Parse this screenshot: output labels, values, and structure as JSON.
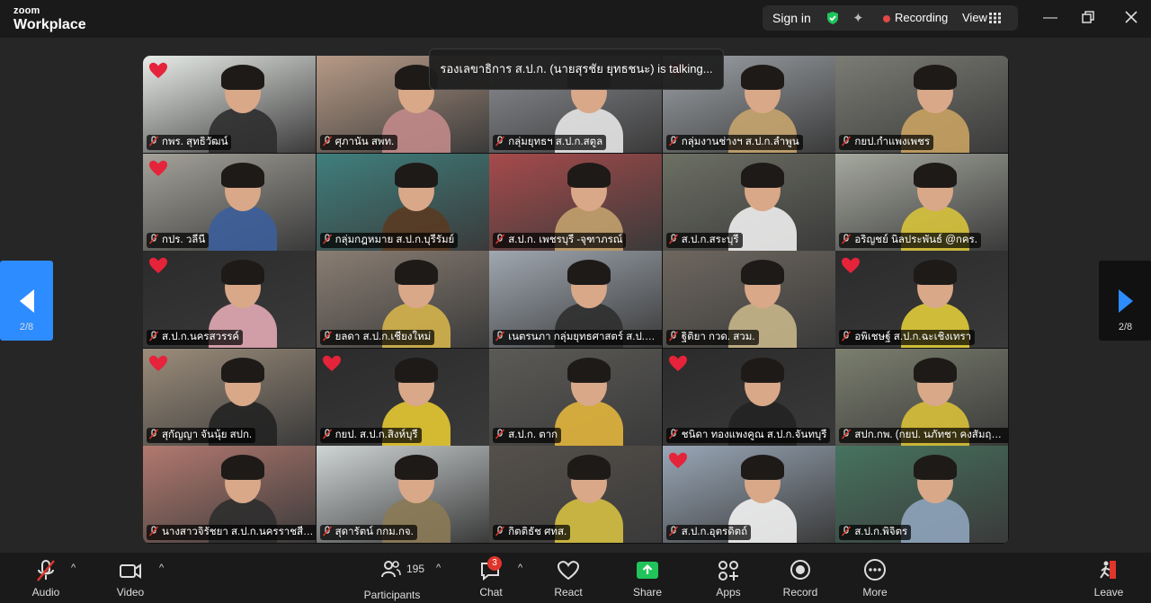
{
  "app": {
    "logo_line1": "zoom",
    "logo_line2": "Workplace"
  },
  "topbar": {
    "sign_in": "Sign in",
    "recording": "Recording",
    "view": "View",
    "recording_dot_color": "#e04848",
    "shield_color": "#21c35b"
  },
  "talking_banner": "รองเลขาธิการ ส.ป.ก. (นายสุรชัย ยุทธชนะ) is talking...",
  "pager": {
    "left": "2/8",
    "right": "2/8"
  },
  "participants": [
    {
      "name": "กพร. สุทธิวัฒน์",
      "heart": true,
      "bg": "#e8ece8",
      "clothes": "#2d2d2d"
    },
    {
      "name": "ศุภานัน สพท.",
      "heart": false,
      "bg": "#b79a86",
      "clothes": "#c28a8a"
    },
    {
      "name": "กลุ่มยุทธฯ ส.ป.ก.สตูล",
      "heart": false,
      "bg": "#8d8f95",
      "clothes": "#e5e5e5"
    },
    {
      "name": "กลุ่มงานช่างฯ ส.ป.ก.ลำพูน",
      "heart": true,
      "bg": "#9ea3a8",
      "clothes": "#c7a46e"
    },
    {
      "name": "กยป.กำแพงเพชร",
      "heart": false,
      "bg": "#7b7c74",
      "clothes": "#c9a262"
    },
    {
      "name": "กปร. วลีนี",
      "heart": true,
      "bg": "#a4a29a",
      "clothes": "#3b5e9b"
    },
    {
      "name": "กลุ่มกฎหมาย ส.ป.ก.บุรีรัมย์",
      "heart": false,
      "bg": "#3e7f7d",
      "clothes": "#5a3b22"
    },
    {
      "name": "ส.ป.ก. เพชรบุรี -จุฑาภรณ์",
      "heart": false,
      "bg": "#a74a4b",
      "clothes": "#c2a16d"
    },
    {
      "name": "ส.ป.ก.สระบุรี",
      "heart": false,
      "bg": "#6d7064",
      "clothes": "#eeeeee"
    },
    {
      "name": "อริญชย์ นิลประพันธ์ @กคร.",
      "heart": false,
      "bg": "#a6a99f",
      "clothes": "#d7c23b"
    },
    {
      "name": "ส.ป.ก.นครสวรรค์",
      "heart": true,
      "bg": "#2b2b2b",
      "clothes": "#e2a8b3"
    },
    {
      "name": "ยลดา ส.ป.ก.เชียงใหม่",
      "heart": false,
      "bg": "#8a7e73",
      "clothes": "#d4b44b"
    },
    {
      "name": "เนตรนภา กลุ่มยุทธศาสตร์ ส.ป.ก.ร้อยเอ็ด",
      "heart": false,
      "bg": "#9fa7b0",
      "clothes": "#2f2f2f"
    },
    {
      "name": "ฐิติยา กวด. สวม.",
      "heart": false,
      "bg": "#6e675f",
      "clothes": "#c7b68a"
    },
    {
      "name": "อพิเชษฐ์ ส.ป.ก.ฉะเชิงเทรา",
      "heart": true,
      "bg": "#2b2b2b",
      "clothes": "#e0cc3a"
    },
    {
      "name": "สุกัญญา จันนุ้ย สปก.",
      "heart": true,
      "bg": "#9c8d7b",
      "clothes": "#222222"
    },
    {
      "name": "กยป. ส.ป.ก.สิงห์บุรี",
      "heart": true,
      "bg": "#2b2b2b",
      "clothes": "#e5c832"
    },
    {
      "name": "ส.ป.ก. ตาก",
      "heart": false,
      "bg": "#5b5a56",
      "clothes": "#e2b53c"
    },
    {
      "name": "ชนิดา ทองแพงคูณ ส.ป.ก.จันทบุรี",
      "heart": true,
      "bg": "#2b2b2b",
      "clothes": "#222222"
    },
    {
      "name": "สปก.กพ. (กยป. นภัทชา คงสัมฤทธิ์)",
      "heart": false,
      "bg": "#7b7f6e",
      "clothes": "#d8c038"
    },
    {
      "name": "นางสาวจิรัชยา ส.ป.ก.นครราชสีมา",
      "heart": false,
      "bg": "#b2796f",
      "clothes": "#2d2d2d"
    },
    {
      "name": "สุดารัตน์ กกม.กจ.",
      "heart": false,
      "bg": "#cfd4d5",
      "clothes": "#8b7a55"
    },
    {
      "name": "กิตติธัช ศทส.",
      "heart": false,
      "bg": "#55504a",
      "clothes": "#d5c041"
    },
    {
      "name": "ส.ป.ก.อุตรดิตถ์",
      "heart": true,
      "bg": "#99a7b7",
      "clothes": "#f2f2f2"
    },
    {
      "name": "ส.ป.ก.พิจิตร",
      "heart": false,
      "bg": "#46735f",
      "clothes": "#8fa4bd"
    }
  ],
  "toolbar": {
    "audio": "Audio",
    "video": "Video",
    "participants": "Participants",
    "participants_count": "195",
    "chat": "Chat",
    "chat_badge": "3",
    "react": "React",
    "share": "Share",
    "apps": "Apps",
    "record": "Record",
    "more": "More",
    "leave": "Leave",
    "share_color": "#21c35b",
    "leave_color": "#e0352b"
  }
}
